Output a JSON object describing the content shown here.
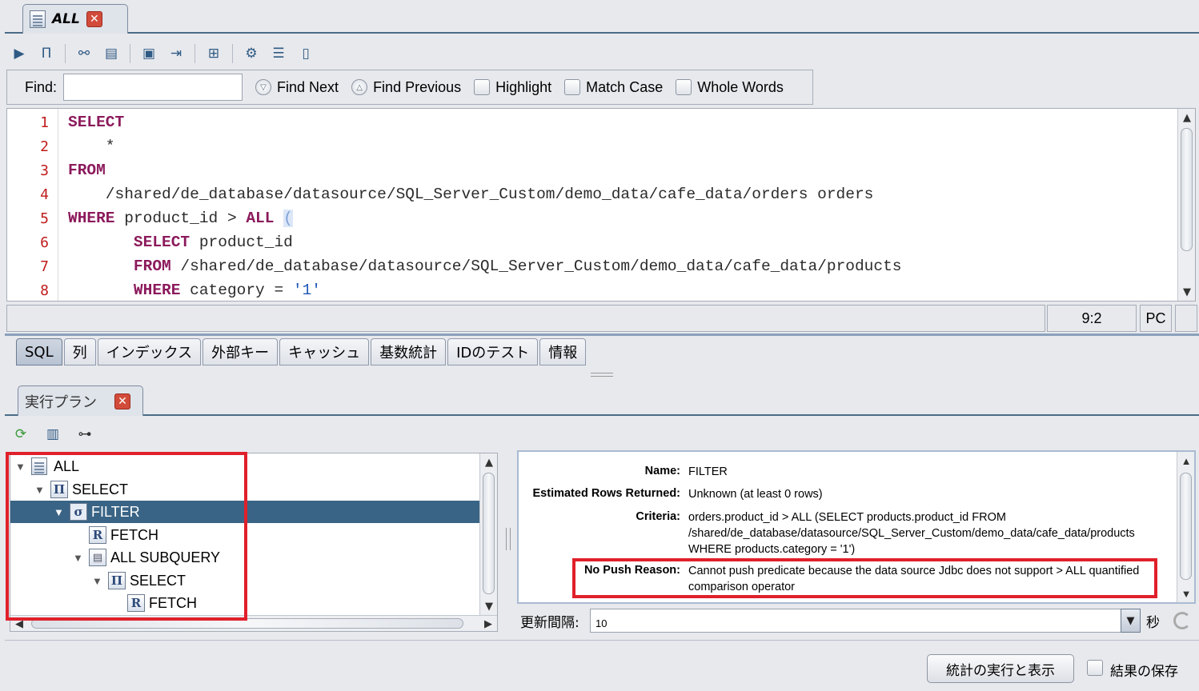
{
  "editor_tab": {
    "label": "ALL",
    "close": "✕"
  },
  "toolbar": {
    "icons": [
      "execute-icon",
      "explain-icon",
      "tree-icon",
      "print-icon",
      "save-icon",
      "export-icon",
      "new-icon",
      "properties-icon",
      "indent-icon",
      "document-icon"
    ]
  },
  "find": {
    "label": "Find:",
    "value": "",
    "find_next": "Find Next",
    "find_previous": "Find Previous",
    "highlight": "Highlight",
    "match_case": "Match Case",
    "whole_words": "Whole Words"
  },
  "code": {
    "line_numbers": [
      "1",
      "2",
      "3",
      "4",
      "5",
      "6",
      "7",
      "8"
    ],
    "l1_kw": "SELECT",
    "l2": "    *",
    "l3_kw": "FROM",
    "l4": "    /shared/de_database/datasource/SQL_Server_Custom/demo_data/cafe_data/orders orders",
    "l5_kw1": "WHERE",
    "l5_mid": " product_id > ",
    "l5_kw2": "ALL",
    "l5_sp": " ",
    "l5_paren": "(",
    "l6_indent": "       ",
    "l6_kw": "SELECT",
    "l6_rest": " product_id",
    "l7_indent": "       ",
    "l7_kw": "FROM",
    "l7_rest": " /shared/de_database/datasource/SQL_Server_Custom/demo_data/cafe_data/products",
    "l8_indent": "       ",
    "l8_kw": "WHERE",
    "l8_rest": " category = ",
    "l8_str": "'1'"
  },
  "status": {
    "position": "9:2",
    "mode": "PC"
  },
  "subtabs": [
    "SQL",
    "列",
    "インデックス",
    "外部キー",
    "キャッシュ",
    "基数統計",
    "IDのテスト",
    "情報"
  ],
  "plan_tab": {
    "label": "実行プラン",
    "close": "✕"
  },
  "tree": {
    "nodes": [
      {
        "label": "ALL",
        "icon": "Π"
      },
      {
        "label": "SELECT",
        "icon": "Π"
      },
      {
        "label": "FILTER",
        "icon": "σ"
      },
      {
        "label": "FETCH",
        "icon": "R"
      },
      {
        "label": "ALL SUBQUERY",
        "icon": "▤"
      },
      {
        "label": "SELECT",
        "icon": "Π"
      },
      {
        "label": "FETCH",
        "icon": "R"
      }
    ]
  },
  "details": {
    "name_label": "Name:",
    "name_value": "FILTER",
    "rows_label": "Estimated Rows Returned:",
    "rows_value": "Unknown (at least 0 rows)",
    "criteria_label": "Criteria:",
    "criteria_value": "orders.product_id > ALL (SELECT products.product_id FROM /shared/de_database/datasource/SQL_Server_Custom/demo_data/cafe_data/products WHERE products.category = '1')",
    "nopush_label": "No Push Reason:",
    "nopush_value": "Cannot push predicate because the data source Jdbc does not support > ALL quantified comparison operator"
  },
  "refresh": {
    "label": "更新間隔:",
    "value": "10",
    "unit": "秒"
  },
  "footer": {
    "run_button": "統計の実行と表示",
    "save_label": "結果の保存"
  },
  "colors": {
    "keyword": "#8c1a5c",
    "string": "#1f57b8",
    "selection": "#3a6485",
    "highlight_box": "#e0202a"
  }
}
